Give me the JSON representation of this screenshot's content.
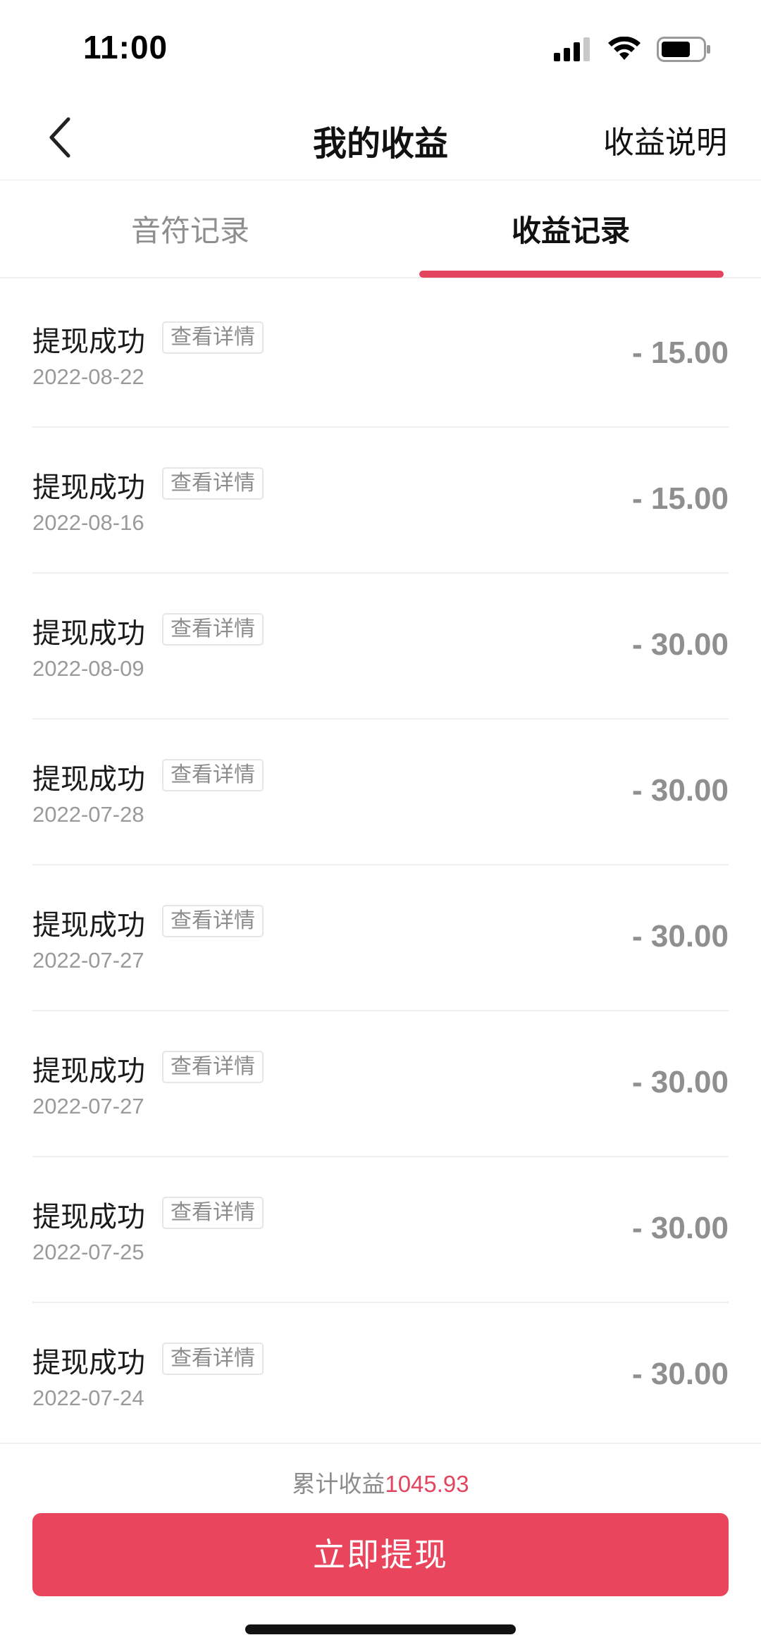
{
  "status_bar": {
    "time": "11:00"
  },
  "nav": {
    "title": "我的收益",
    "right_link": "收益说明"
  },
  "tabs": [
    {
      "label": "音符记录",
      "active": false
    },
    {
      "label": "收益记录",
      "active": true
    }
  ],
  "records": [
    {
      "title": "提现成功",
      "detail_label": "查看详情",
      "date": "2022-08-22",
      "amount": "- 15.00"
    },
    {
      "title": "提现成功",
      "detail_label": "查看详情",
      "date": "2022-08-16",
      "amount": "- 15.00"
    },
    {
      "title": "提现成功",
      "detail_label": "查看详情",
      "date": "2022-08-09",
      "amount": "- 30.00"
    },
    {
      "title": "提现成功",
      "detail_label": "查看详情",
      "date": "2022-07-28",
      "amount": "- 30.00"
    },
    {
      "title": "提现成功",
      "detail_label": "查看详情",
      "date": "2022-07-27",
      "amount": "- 30.00"
    },
    {
      "title": "提现成功",
      "detail_label": "查看详情",
      "date": "2022-07-27",
      "amount": "- 30.00"
    },
    {
      "title": "提现成功",
      "detail_label": "查看详情",
      "date": "2022-07-25",
      "amount": "- 30.00"
    },
    {
      "title": "提现成功",
      "detail_label": "查看详情",
      "date": "2022-07-24",
      "amount": "- 30.00"
    }
  ],
  "footer": {
    "total_label": "累计收益",
    "total_value": "1045.93",
    "withdraw_button": "立即提现"
  },
  "colors": {
    "accent": "#e9465e",
    "amount": "#8f8f8f"
  }
}
